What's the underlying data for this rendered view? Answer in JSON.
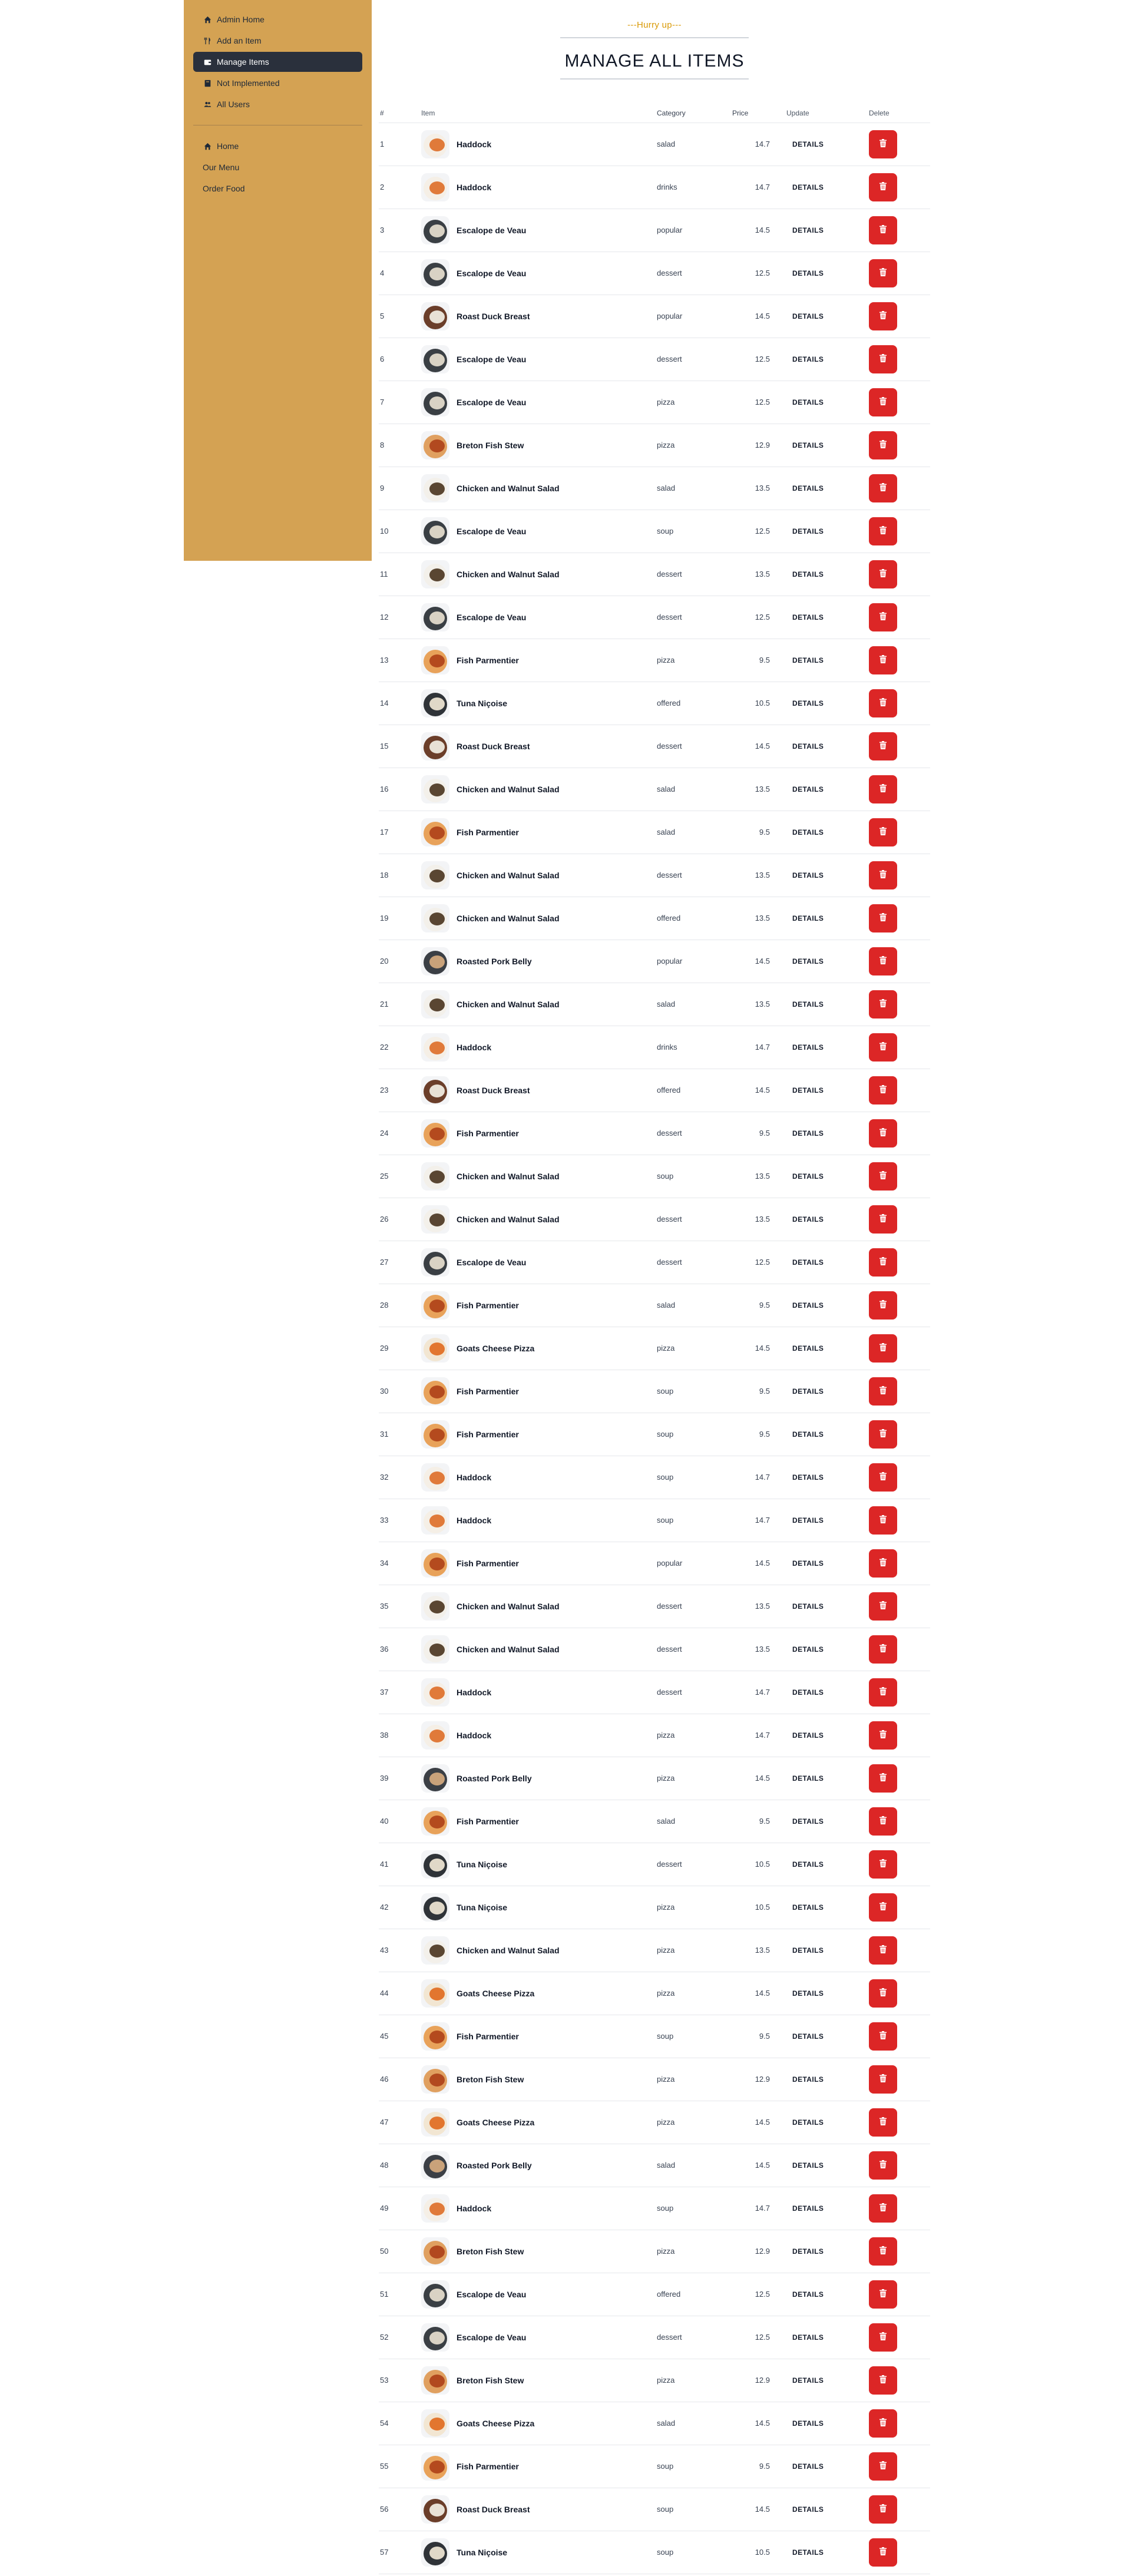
{
  "sidebar": {
    "admin_links": [
      {
        "label": "Admin Home",
        "icon": "home-icon"
      },
      {
        "label": "Add an Item",
        "icon": "utensils-icon"
      },
      {
        "label": "Manage Items",
        "icon": "wallet-icon"
      },
      {
        "label": "Not Implemented",
        "icon": "book-icon"
      },
      {
        "label": "All Users",
        "icon": "users-icon"
      }
    ],
    "active_index": 2,
    "public_links": [
      {
        "label": "Home",
        "icon": "home-icon"
      },
      {
        "label": "Our Menu",
        "icon": ""
      },
      {
        "label": "Order Food",
        "icon": ""
      }
    ]
  },
  "heading": {
    "subtitle": "---Hurry up---",
    "title": "MANAGE ALL ITEMS"
  },
  "table": {
    "headers": [
      "#",
      "Item",
      "Category",
      "Price",
      "Update",
      "Delete"
    ],
    "details_label": "DETAILS",
    "rows": [
      {
        "num": "1",
        "name": "Haddock",
        "category": "salad",
        "price": "14.7"
      },
      {
        "num": "2",
        "name": "Haddock",
        "category": "drinks",
        "price": "14.7"
      },
      {
        "num": "3",
        "name": "Escalope de Veau",
        "category": "popular",
        "price": "14.5"
      },
      {
        "num": "4",
        "name": "Escalope de Veau",
        "category": "dessert",
        "price": "12.5"
      },
      {
        "num": "5",
        "name": "Roast Duck Breast",
        "category": "popular",
        "price": "14.5"
      },
      {
        "num": "6",
        "name": "Escalope de Veau",
        "category": "dessert",
        "price": "12.5"
      },
      {
        "num": "7",
        "name": "Escalope de Veau",
        "category": "pizza",
        "price": "12.5"
      },
      {
        "num": "8",
        "name": "Breton Fish Stew",
        "category": "pizza",
        "price": "12.9"
      },
      {
        "num": "9",
        "name": "Chicken and Walnut Salad",
        "category": "salad",
        "price": "13.5"
      },
      {
        "num": "10",
        "name": "Escalope de Veau",
        "category": "soup",
        "price": "12.5"
      },
      {
        "num": "11",
        "name": "Chicken and Walnut Salad",
        "category": "dessert",
        "price": "13.5"
      },
      {
        "num": "12",
        "name": "Escalope de Veau",
        "category": "dessert",
        "price": "12.5"
      },
      {
        "num": "13",
        "name": "Fish Parmentier",
        "category": "pizza",
        "price": "9.5"
      },
      {
        "num": "14",
        "name": "Tuna Niçoise",
        "category": "offered",
        "price": "10.5"
      },
      {
        "num": "15",
        "name": "Roast Duck Breast",
        "category": "dessert",
        "price": "14.5"
      },
      {
        "num": "16",
        "name": "Chicken and Walnut Salad",
        "category": "salad",
        "price": "13.5"
      },
      {
        "num": "17",
        "name": "Fish Parmentier",
        "category": "salad",
        "price": "9.5"
      },
      {
        "num": "18",
        "name": "Chicken and Walnut Salad",
        "category": "dessert",
        "price": "13.5"
      },
      {
        "num": "19",
        "name": "Chicken and Walnut Salad",
        "category": "offered",
        "price": "13.5"
      },
      {
        "num": "20",
        "name": "Roasted Pork Belly",
        "category": "popular",
        "price": "14.5"
      },
      {
        "num": "21",
        "name": "Chicken and Walnut Salad",
        "category": "salad",
        "price": "13.5"
      },
      {
        "num": "22",
        "name": "Haddock",
        "category": "drinks",
        "price": "14.7"
      },
      {
        "num": "23",
        "name": "Roast Duck Breast",
        "category": "offered",
        "price": "14.5"
      },
      {
        "num": "24",
        "name": "Fish Parmentier",
        "category": "dessert",
        "price": "9.5"
      },
      {
        "num": "25",
        "name": "Chicken and Walnut Salad",
        "category": "soup",
        "price": "13.5"
      },
      {
        "num": "26",
        "name": "Chicken and Walnut Salad",
        "category": "dessert",
        "price": "13.5"
      },
      {
        "num": "27",
        "name": "Escalope de Veau",
        "category": "dessert",
        "price": "12.5"
      },
      {
        "num": "28",
        "name": "Fish Parmentier",
        "category": "salad",
        "price": "9.5"
      },
      {
        "num": "29",
        "name": "Goats Cheese Pizza",
        "category": "pizza",
        "price": "14.5"
      },
      {
        "num": "30",
        "name": "Fish Parmentier",
        "category": "soup",
        "price": "9.5"
      },
      {
        "num": "31",
        "name": "Fish Parmentier",
        "category": "soup",
        "price": "9.5"
      },
      {
        "num": "32",
        "name": "Haddock",
        "category": "soup",
        "price": "14.7"
      },
      {
        "num": "33",
        "name": "Haddock",
        "category": "soup",
        "price": "14.7"
      },
      {
        "num": "34",
        "name": "Fish Parmentier",
        "category": "popular",
        "price": "14.5"
      },
      {
        "num": "35",
        "name": "Chicken and Walnut Salad",
        "category": "dessert",
        "price": "13.5"
      },
      {
        "num": "36",
        "name": "Chicken and Walnut Salad",
        "category": "dessert",
        "price": "13.5"
      },
      {
        "num": "37",
        "name": "Haddock",
        "category": "dessert",
        "price": "14.7"
      },
      {
        "num": "38",
        "name": "Haddock",
        "category": "pizza",
        "price": "14.7"
      },
      {
        "num": "39",
        "name": "Roasted Pork Belly",
        "category": "pizza",
        "price": "14.5"
      },
      {
        "num": "40",
        "name": "Fish Parmentier",
        "category": "salad",
        "price": "9.5"
      },
      {
        "num": "41",
        "name": "Tuna Niçoise",
        "category": "dessert",
        "price": "10.5"
      },
      {
        "num": "42",
        "name": "Tuna Niçoise",
        "category": "pizza",
        "price": "10.5"
      },
      {
        "num": "43",
        "name": "Chicken and Walnut Salad",
        "category": "pizza",
        "price": "13.5"
      },
      {
        "num": "44",
        "name": "Goats Cheese Pizza",
        "category": "pizza",
        "price": "14.5"
      },
      {
        "num": "45",
        "name": "Fish Parmentier",
        "category": "soup",
        "price": "9.5"
      },
      {
        "num": "46",
        "name": "Breton Fish Stew",
        "category": "pizza",
        "price": "12.9"
      },
      {
        "num": "47",
        "name": "Goats Cheese Pizza",
        "category": "pizza",
        "price": "14.5"
      },
      {
        "num": "48",
        "name": "Roasted Pork Belly",
        "category": "salad",
        "price": "14.5"
      },
      {
        "num": "49",
        "name": "Haddock",
        "category": "soup",
        "price": "14.7"
      },
      {
        "num": "50",
        "name": "Breton Fish Stew",
        "category": "pizza",
        "price": "12.9"
      },
      {
        "num": "51",
        "name": "Escalope de Veau",
        "category": "offered",
        "price": "12.5"
      },
      {
        "num": "52",
        "name": "Escalope de Veau",
        "category": "dessert",
        "price": "12.5"
      },
      {
        "num": "53",
        "name": "Breton Fish Stew",
        "category": "pizza",
        "price": "12.9"
      },
      {
        "num": "54",
        "name": "Goats Cheese Pizza",
        "category": "salad",
        "price": "14.5"
      },
      {
        "num": "55",
        "name": "Fish Parmentier",
        "category": "soup",
        "price": "9.5"
      },
      {
        "num": "56",
        "name": "Roast Duck Breast",
        "category": "soup",
        "price": "14.5"
      },
      {
        "num": "57",
        "name": "Tuna Niçoise",
        "category": "soup",
        "price": "10.5"
      }
    ]
  },
  "colors": {
    "sidebar_bg": "#d4a253",
    "active_link_bg": "#2a303c",
    "accent": "#d99904",
    "delete_button": "#dc2626"
  }
}
